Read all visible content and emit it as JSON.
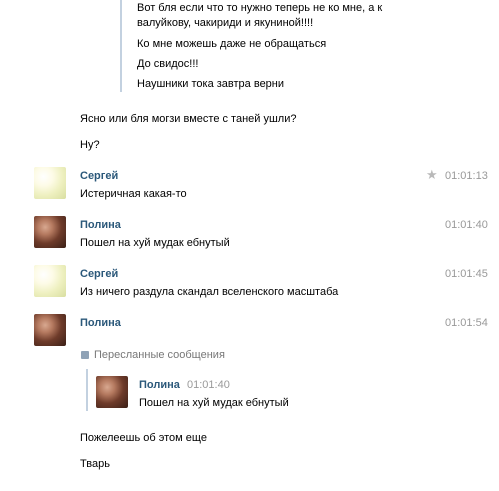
{
  "top_quote": {
    "lines": [
      "Вот бля если что то нужно теперь не ко мне, а к",
      "валуйкову, чакириди и якуниной!!!!",
      "Ко мне можешь даже не обращаться",
      "До свидос!!!",
      "Наушники тока завтра верни"
    ]
  },
  "loose_messages_top": [
    "Ясно или бля могзи вместе с таней ушли?",
    "Ну?"
  ],
  "messages": [
    {
      "author": "Сергей",
      "time": "01:01:13",
      "text": "Истеричная какая-то",
      "avatar": "sergey-avatar",
      "starred": true
    },
    {
      "author": "Полина",
      "time": "01:01:40",
      "text": "Пошел на хуй мудак ебнутый",
      "avatar": "polina-avatar",
      "starred": false
    },
    {
      "author": "Сергей",
      "time": "01:01:45",
      "text": "Из ничего раздула скандал вселенского масштаба",
      "avatar": "sergey-avatar",
      "starred": false
    },
    {
      "author": "Полина",
      "time": "01:01:54",
      "text": "",
      "avatar": "polina-avatar",
      "starred": false
    }
  ],
  "forwarded": {
    "label": "Пересланные сообщения",
    "author": "Полина",
    "time": "01:01:40",
    "text": "Пошел на хуй мудак ебнутый"
  },
  "loose_messages_bottom": [
    "Пожелеешь об этом еще",
    "Тварь"
  ],
  "icons": {
    "star": "star-icon",
    "forward": "forward-icon"
  },
  "colors": {
    "author_name": "#2b587a",
    "time": "#999999",
    "quote_bar": "#c3d1e0"
  }
}
